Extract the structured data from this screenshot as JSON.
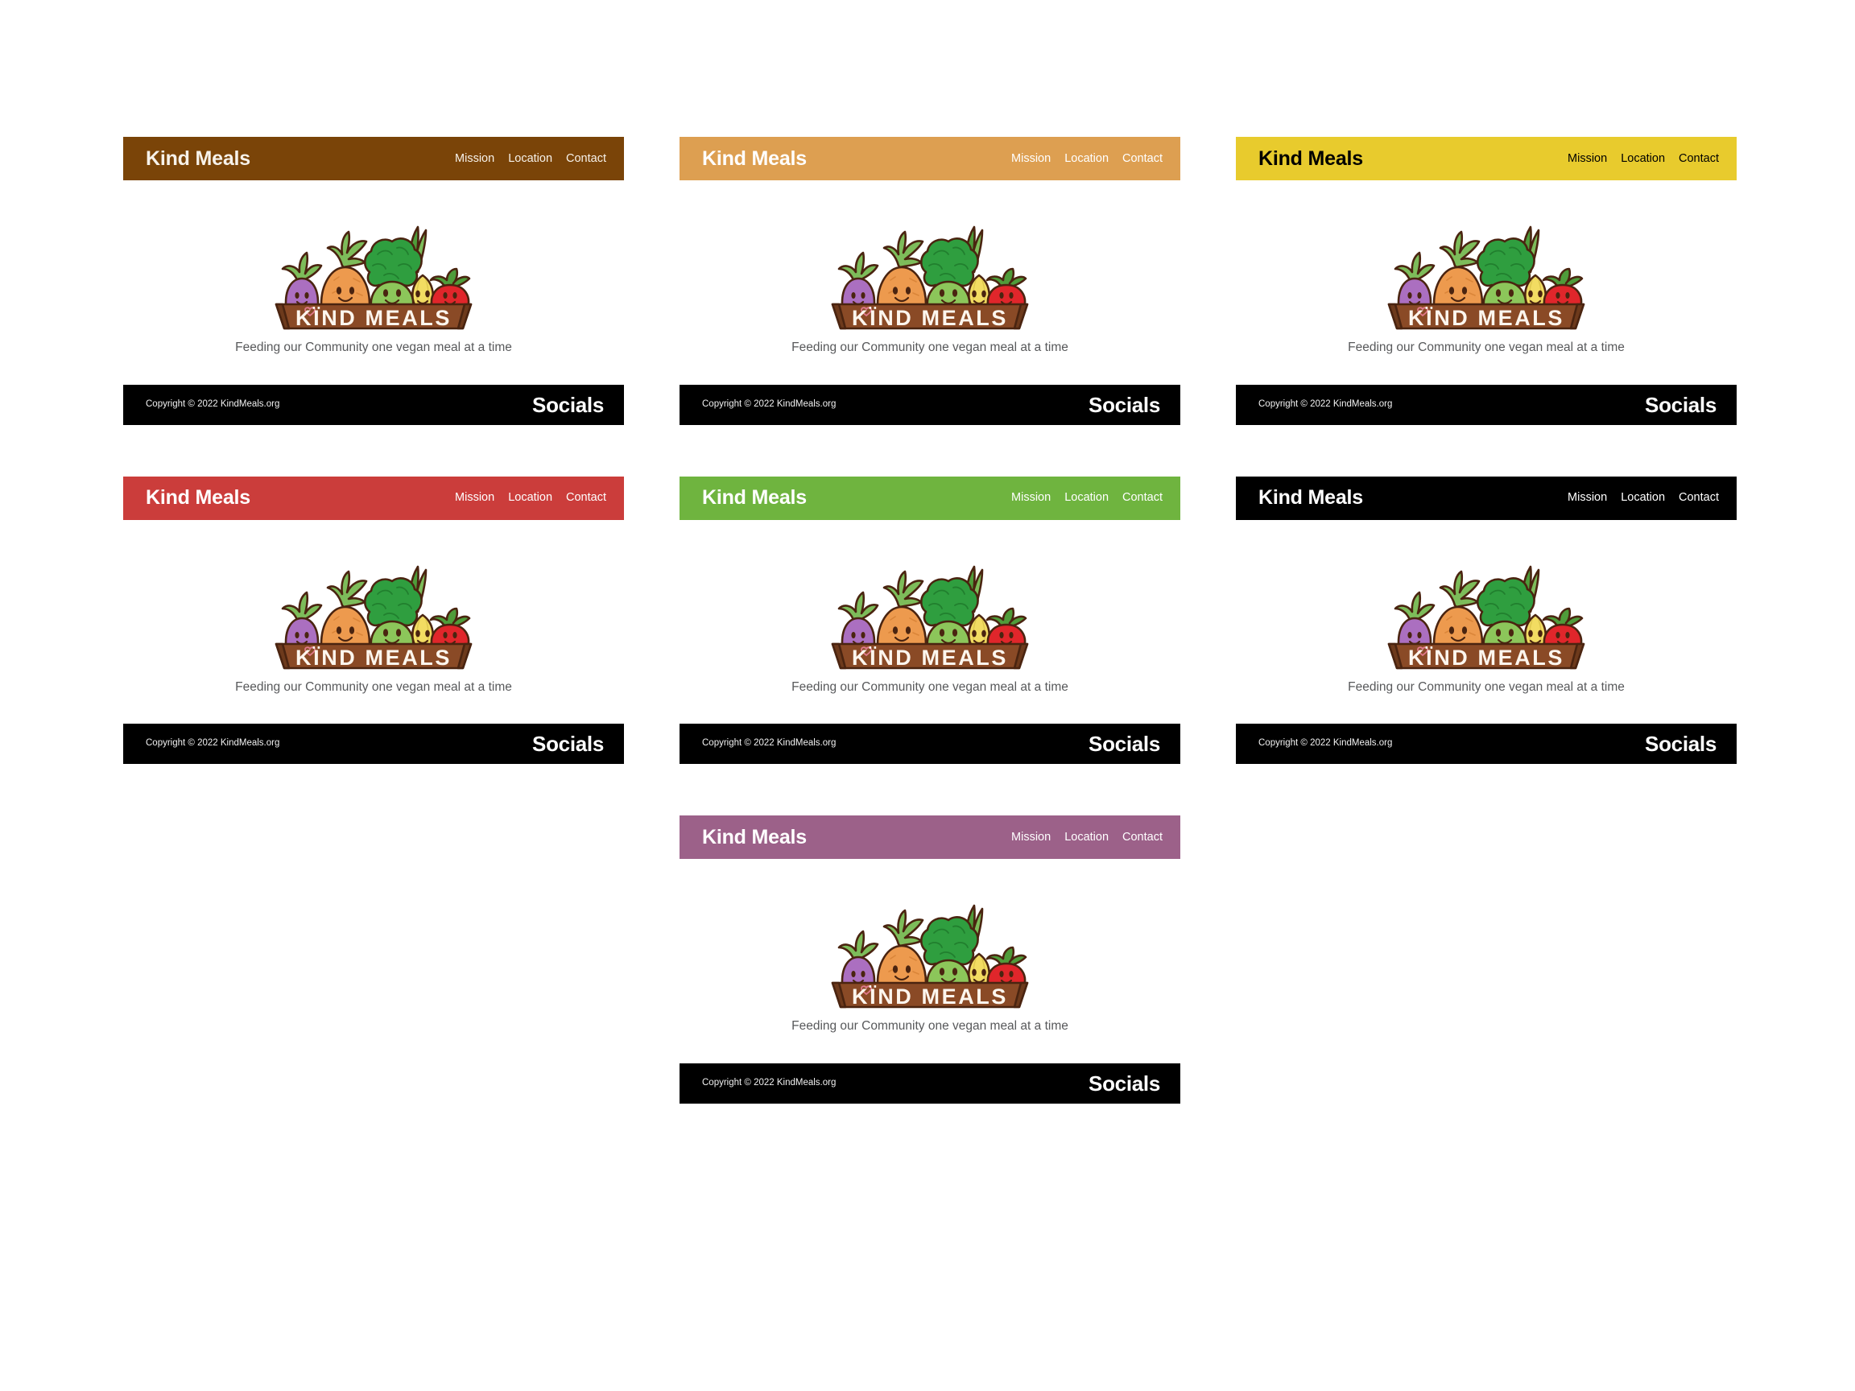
{
  "page": {
    "background": "#ffffff",
    "title": "Kind Meals"
  },
  "shared": {
    "brand": "Kind Meals",
    "nav": [
      {
        "label": "Mission",
        "name": "nav-link-mission"
      },
      {
        "label": "Location",
        "name": "nav-link-location"
      },
      {
        "label": "Contact",
        "name": "nav-link-contact"
      }
    ],
    "logo_alt": "KÏND MEALS",
    "logo_text": "KÏND MEALS",
    "tagline": "Feeding our Community one vegan meal at a time",
    "footer": {
      "copyright": "Copyright © 2022 KindMeals.org",
      "socials_label": "Socials",
      "background": "#000000",
      "text_color": "#ffffff"
    },
    "tagline_color": "#58595b"
  },
  "variants": [
    {
      "name": "brown",
      "header_bg": "#7a4408",
      "header_text": "#f7f2ea",
      "nav_text": "#f7f2ea"
    },
    {
      "name": "tan",
      "header_bg": "#dd9f51",
      "header_text": "#ffffff",
      "nav_text": "#ffffff"
    },
    {
      "name": "yellow",
      "header_bg": "#e8cb2d",
      "header_text": "#000000",
      "nav_text": "#000000"
    },
    {
      "name": "red",
      "header_bg": "#cb3d3b",
      "header_text": "#ffffff",
      "nav_text": "#ffffff"
    },
    {
      "name": "green",
      "header_bg": "#6fb43f",
      "header_text": "#ffffff",
      "nav_text": "#ffffff"
    },
    {
      "name": "black",
      "header_bg": "#000000",
      "header_text": "#ffffff",
      "nav_text": "#ffffff"
    },
    {
      "name": "empty-left",
      "header_bg": "#ffffff",
      "header_text": "#ffffff",
      "nav_text": "#ffffff",
      "hidden": true
    },
    {
      "name": "purple",
      "header_bg": "#9c6189",
      "header_text": "#ffffff",
      "nav_text": "#ffffff"
    },
    {
      "name": "empty-right",
      "header_bg": "#ffffff",
      "header_text": "#ffffff",
      "nav_text": "#ffffff",
      "hidden": true
    }
  ],
  "logo_colors": {
    "outline": "#4a2410",
    "crate": "#8a4a26",
    "crate_dark": "#6d3a1c",
    "eggplant": "#ab6fc0",
    "carrot": "#ed9a4e",
    "broccoli_head": "#2f9e3f",
    "broccoli_body": "#8cc65a",
    "onion": "#f2dc62",
    "tomato": "#e0262b",
    "leaf_green": "#7dbc5a",
    "leaf_dark": "#4f9c3a",
    "logo_word": "#fdf6ee",
    "heart": "#e07a8b"
  }
}
